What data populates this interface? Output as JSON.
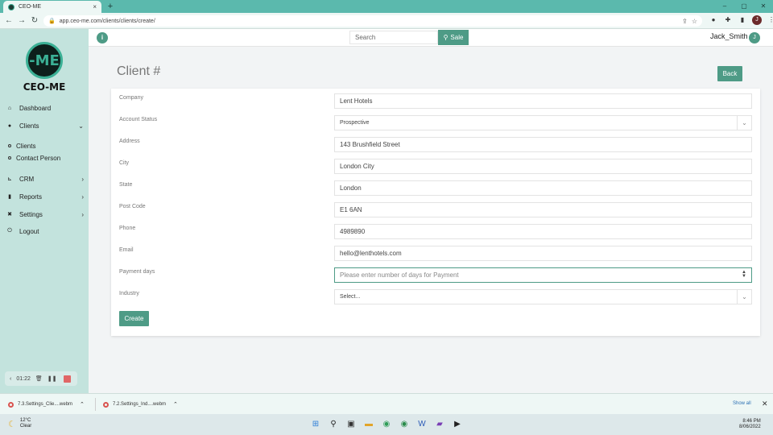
{
  "browser": {
    "tab_title": "CEO-ME",
    "tab_close": "×",
    "new_tab": "+",
    "url": "app.ceo-me.com/clients/clients/create/",
    "window_controls": [
      "–",
      "▢",
      "✕"
    ]
  },
  "app": {
    "logo_mark": "-ME",
    "logo_text": "CEO-ME",
    "search_placeholder": "Search",
    "sale_label": "Sale",
    "user_name": "Jack_Smith",
    "user_initial": "J",
    "info_icon": "i"
  },
  "sidebar": {
    "items": [
      {
        "label": "Dashboard",
        "icon": "home-icon"
      },
      {
        "label": "Clients",
        "icon": "users-icon",
        "expanded": true
      },
      {
        "label": "CRM",
        "icon": "crm-icon"
      },
      {
        "label": "Reports",
        "icon": "reports-icon"
      },
      {
        "label": "Settings",
        "icon": "settings-icon"
      },
      {
        "label": "Logout",
        "icon": "logout-icon"
      }
    ],
    "sub_items": [
      "Clients",
      "Contact Person"
    ]
  },
  "recorder": {
    "time": "01:22"
  },
  "page": {
    "title": "Client #",
    "back_label": "Back",
    "create_label": "Create"
  },
  "form": {
    "fields": [
      {
        "label": "Company",
        "value": "Lent Hotels"
      },
      {
        "label": "Account Status",
        "value": "Prospective"
      },
      {
        "label": "Address",
        "value": "143 Brushfield Street"
      },
      {
        "label": "City",
        "value": "London City"
      },
      {
        "label": "State",
        "value": "London"
      },
      {
        "label": "Post Code",
        "value": "E1 6AN"
      },
      {
        "label": "Phone",
        "value": "4989890"
      },
      {
        "label": "Email",
        "value": "hello@lenthotels.com"
      },
      {
        "label": "Payment days",
        "placeholder": "Please enter number of days for Payment"
      },
      {
        "label": "Industry",
        "value": "Select..."
      }
    ]
  },
  "downloads": {
    "items": [
      "7.3.Settings_Clie....webm",
      "7.2.Settings_Ind....webm"
    ],
    "show_all": "Show all"
  },
  "taskbar": {
    "weather_temp": "12°C",
    "weather_desc": "Clear",
    "time": "8:46 PM",
    "date": "8/06/2022"
  },
  "colors": {
    "accent": "#4e9b86",
    "sidebar_bg": "#c3e3dd",
    "chrome_tab_bar": "#5bb9ad"
  }
}
